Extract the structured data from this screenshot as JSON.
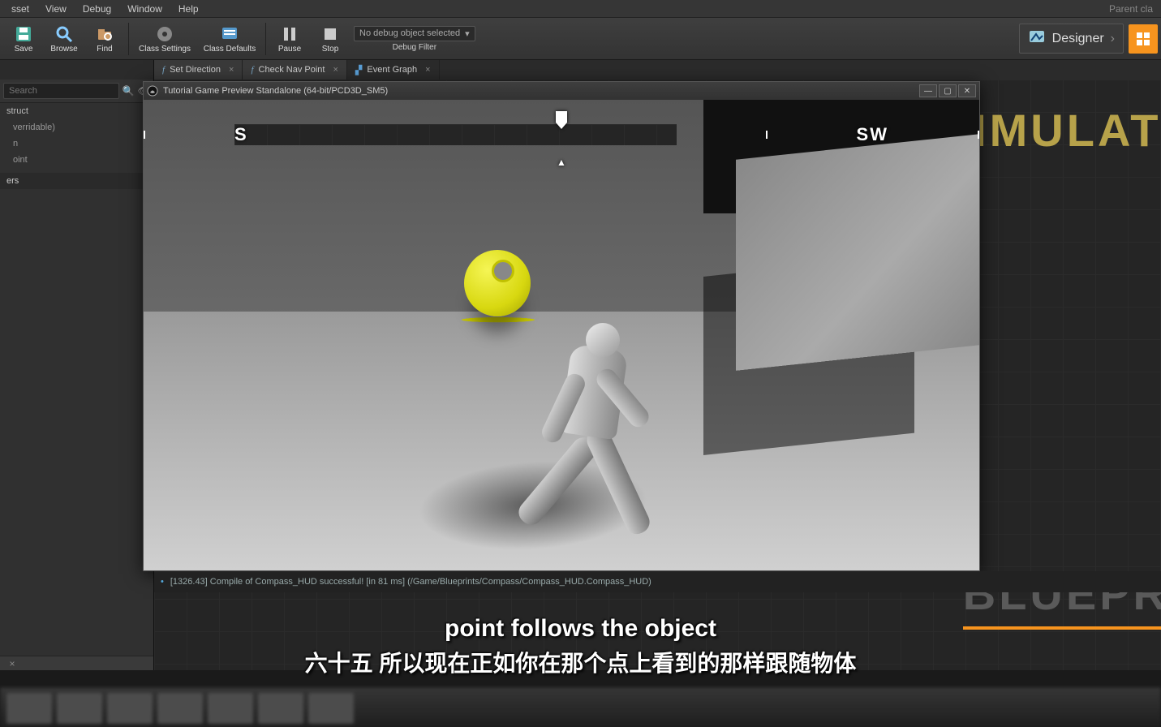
{
  "menu": {
    "items": [
      "sset",
      "View",
      "Debug",
      "Window",
      "Help"
    ],
    "right": "Parent cla"
  },
  "toolbar": {
    "save": "Save",
    "browse": "Browse",
    "find": "Find",
    "classSettings": "Class Settings",
    "classDefaults": "Class Defaults",
    "pause": "Pause",
    "stop": "Stop",
    "debugCombo": "No debug object selected",
    "debugCaption": "Debug Filter",
    "designer": "Designer"
  },
  "tabs": {
    "t1": "Set Direction",
    "t2": "Check Nav Point",
    "t3": "Event Graph"
  },
  "left": {
    "searchPlaceholder": "Search",
    "items": [
      "struct",
      "verridable)",
      "n",
      "oint"
    ],
    "section": "ers"
  },
  "gamewin": {
    "title": "Tutorial Game Preview Standalone (64-bit/PCD3D_SM5)",
    "compass": {
      "s": "S",
      "sw": "SW"
    }
  },
  "log": "[1326.43] Compile of Compass_HUD successful! [in 81 ms] (/Game/Blueprints/Compass/Compass_HUD.Compass_HUD)",
  "watermarks": {
    "sim": "IMULATI",
    "bp": "BLUEPR"
  },
  "subtitles": {
    "en": "point follows the object",
    "zh": "六十五 所以现在正如你在那个点上看到的那样跟随物体"
  }
}
